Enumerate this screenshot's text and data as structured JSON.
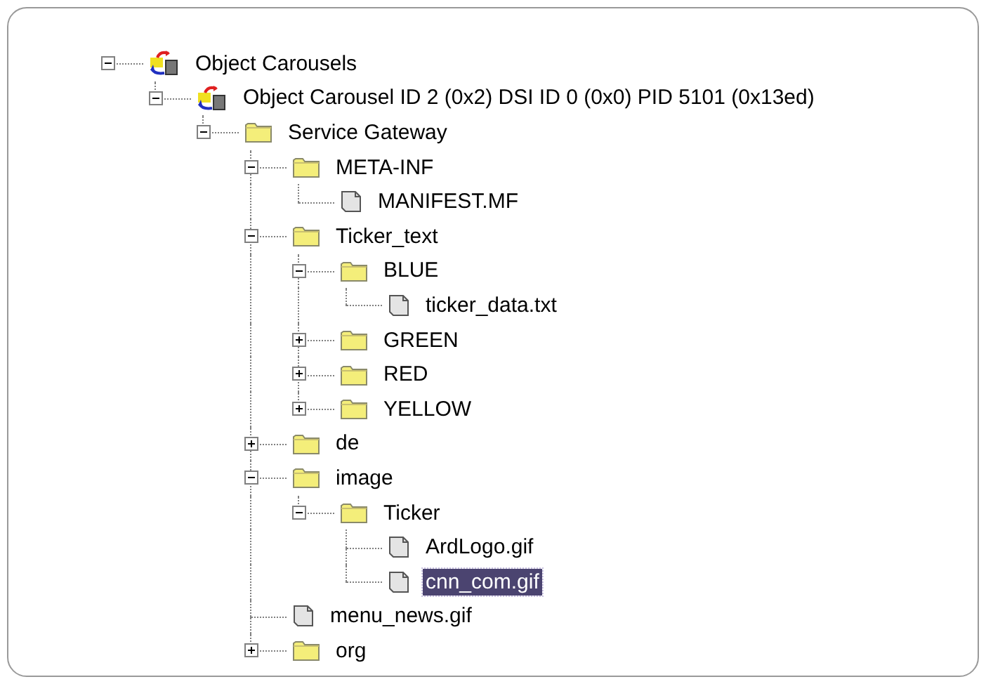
{
  "tree": [
    {
      "label": "Object Carousels",
      "kind": "carousel",
      "expanded": true,
      "selected": false,
      "children": [
        {
          "label": "Object Carousel ID 2 (0x2) DSI ID 0 (0x0) PID 5101 (0x13ed)",
          "kind": "carousel",
          "expanded": true,
          "selected": false,
          "children": [
            {
              "label": "Service Gateway",
              "kind": "folder",
              "expanded": true,
              "selected": false,
              "children": [
                {
                  "label": "META-INF",
                  "kind": "folder",
                  "expanded": true,
                  "selected": false,
                  "children": [
                    {
                      "label": "MANIFEST.MF",
                      "kind": "file",
                      "selected": false
                    }
                  ]
                },
                {
                  "label": "Ticker_text",
                  "kind": "folder",
                  "expanded": true,
                  "selected": false,
                  "children": [
                    {
                      "label": "BLUE",
                      "kind": "folder",
                      "expanded": true,
                      "selected": false,
                      "children": [
                        {
                          "label": "ticker_data.txt",
                          "kind": "file",
                          "selected": false
                        }
                      ]
                    },
                    {
                      "label": "GREEN",
                      "kind": "folder",
                      "expanded": false,
                      "selected": false
                    },
                    {
                      "label": "RED",
                      "kind": "folder",
                      "expanded": false,
                      "selected": false
                    },
                    {
                      "label": "YELLOW",
                      "kind": "folder",
                      "expanded": false,
                      "selected": false
                    }
                  ]
                },
                {
                  "label": "de",
                  "kind": "folder",
                  "expanded": false,
                  "selected": false
                },
                {
                  "label": "image",
                  "kind": "folder",
                  "expanded": true,
                  "selected": false,
                  "children": [
                    {
                      "label": "Ticker",
                      "kind": "folder",
                      "expanded": true,
                      "selected": false,
                      "children": [
                        {
                          "label": "ArdLogo.gif",
                          "kind": "file",
                          "selected": false
                        },
                        {
                          "label": "cnn_com.gif",
                          "kind": "file",
                          "selected": true
                        }
                      ]
                    }
                  ]
                },
                {
                  "label": "menu_news.gif",
                  "kind": "file",
                  "selected": false
                },
                {
                  "label": "org",
                  "kind": "folder",
                  "expanded": false,
                  "selected": false
                }
              ]
            }
          ]
        }
      ]
    }
  ]
}
